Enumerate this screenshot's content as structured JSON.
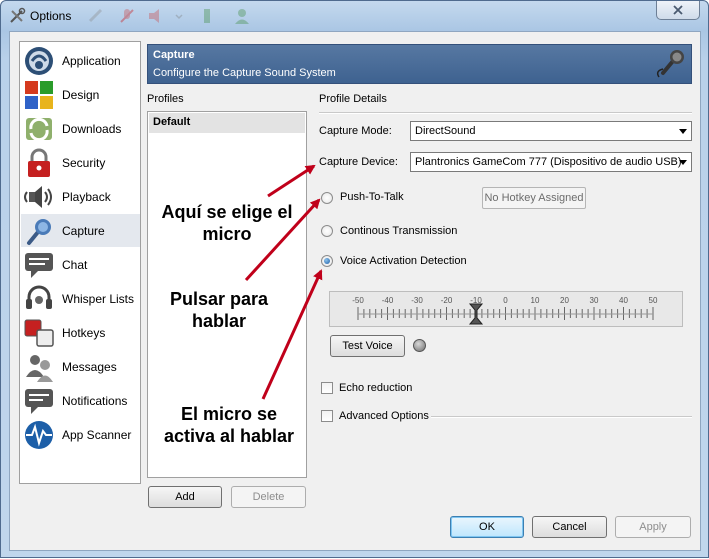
{
  "window": {
    "title": "Options"
  },
  "sidebar": {
    "items": [
      {
        "label": "Application",
        "icon": "teamspeak-logo-icon"
      },
      {
        "label": "Design",
        "icon": "color-grid-icon"
      },
      {
        "label": "Downloads",
        "icon": "download-arrows-icon"
      },
      {
        "label": "Security",
        "icon": "padlock-icon"
      },
      {
        "label": "Playback",
        "icon": "speaker-icon"
      },
      {
        "label": "Capture",
        "icon": "microphone-icon",
        "selected": true
      },
      {
        "label": "Chat",
        "icon": "chat-bubble-icon"
      },
      {
        "label": "Whisper Lists",
        "icon": "headset-icon"
      },
      {
        "label": "Hotkeys",
        "icon": "keys-icon"
      },
      {
        "label": "Messages",
        "icon": "users-icon"
      },
      {
        "label": "Notifications",
        "icon": "notification-bubble-icon"
      },
      {
        "label": "App Scanner",
        "icon": "wave-globe-icon"
      }
    ]
  },
  "header": {
    "title": "Capture",
    "subtitle": "Configure the Capture Sound System"
  },
  "profiles": {
    "label": "Profiles",
    "items": [
      "Default"
    ],
    "add_label": "Add",
    "delete_label": "Delete"
  },
  "details": {
    "label": "Profile Details",
    "capture_mode_label": "Capture Mode:",
    "capture_mode_value": "DirectSound",
    "capture_device_label": "Capture Device:",
    "capture_device_value": "Plantronics GameCom 777 (Dispositivo de audio USB)",
    "push_to_talk_label": "Push-To-Talk",
    "hotkey_label": "No Hotkey Assigned",
    "continuous_label": "Continous Transmission",
    "vad_label": "Voice Activation Detection",
    "selected_mode": "vad",
    "slider_ticks": [
      "-50",
      "-40",
      "-30",
      "-20",
      "-10",
      "0",
      "10",
      "20",
      "30",
      "40",
      "50"
    ],
    "slider_value": -10,
    "test_voice_label": "Test Voice",
    "echo_label": "Echo reduction",
    "echo_checked": false,
    "advanced_label": "Advanced Options",
    "advanced_checked": false
  },
  "footer": {
    "ok_label": "OK",
    "cancel_label": "Cancel",
    "apply_label": "Apply"
  },
  "annotations": [
    {
      "line1": "Aquí se elige el",
      "line2": "micro"
    },
    {
      "line1": "Pulsar para",
      "line2": "hablar"
    },
    {
      "line1": "El micro se",
      "line2": "activa al hablar"
    }
  ],
  "colors": {
    "header_bg": "#4a6d99",
    "annotation_arrow": "#c0001a",
    "selected_row": "#e4e8ee"
  }
}
